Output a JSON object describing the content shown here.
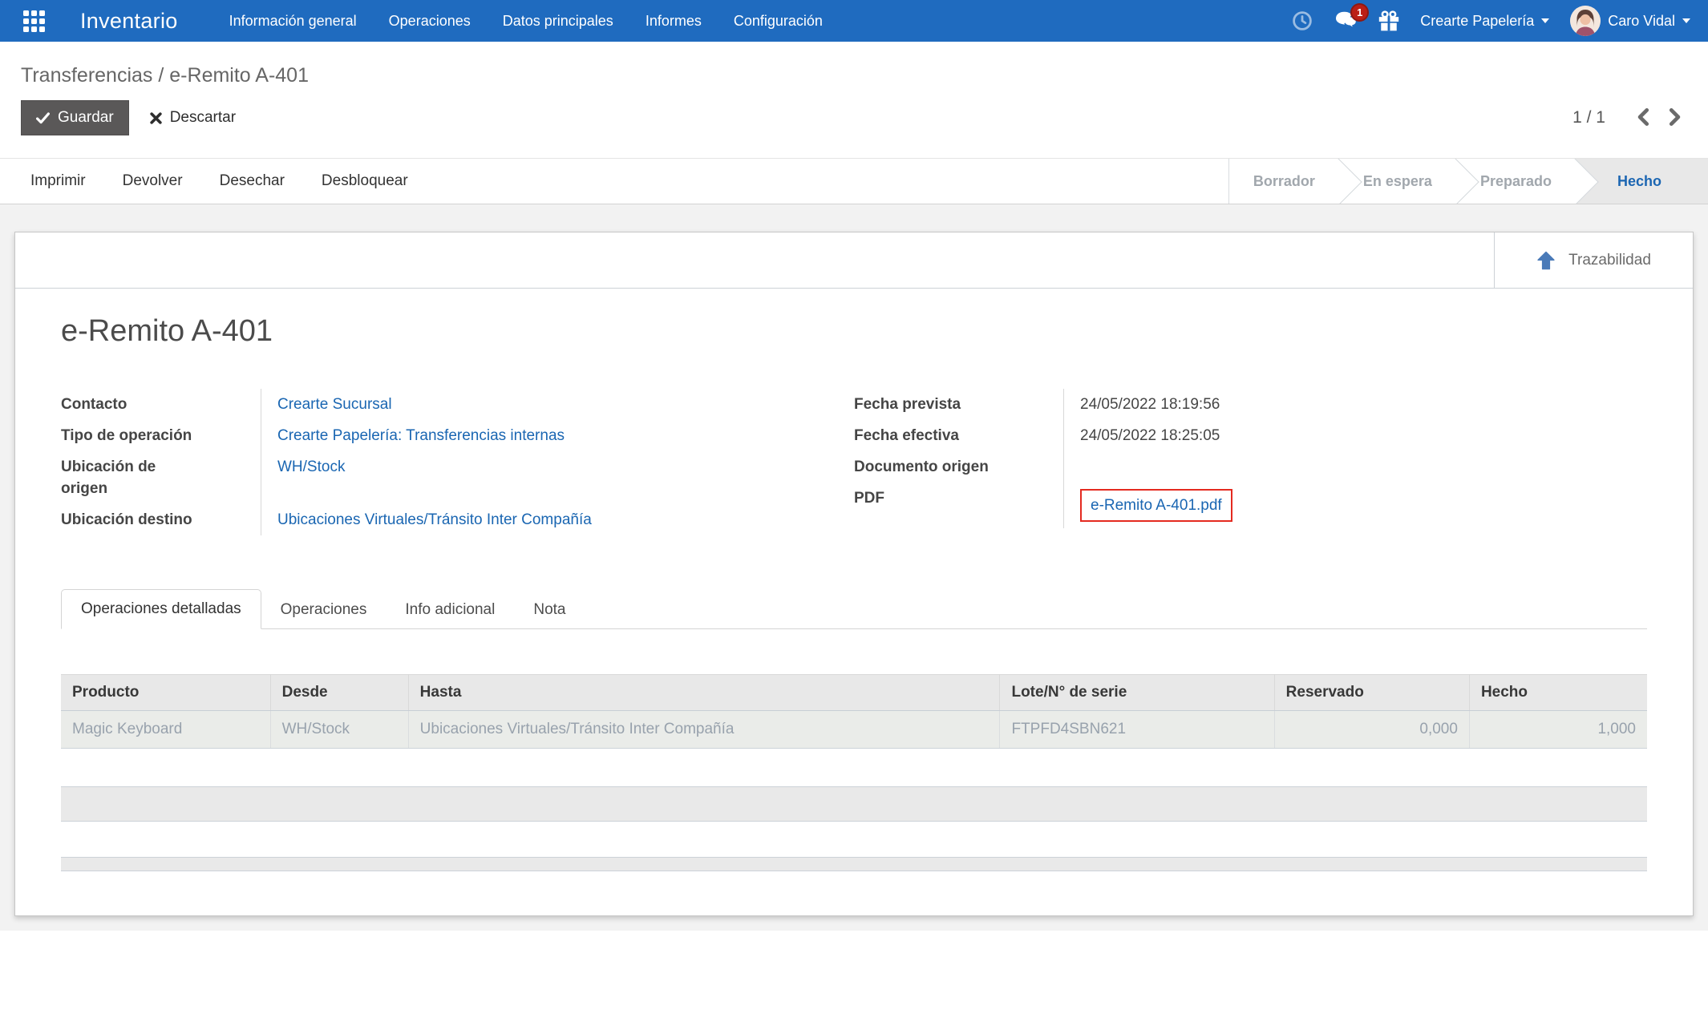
{
  "colors": {
    "navbar_blue": "#1f6bbf",
    "link_blue": "#1a66b2",
    "badge_red": "#bb1f16",
    "highlight_red": "#e42a20",
    "active_status_blue": "#1c66b2"
  },
  "navbar": {
    "brand": "Inventario",
    "menus": [
      "Información general",
      "Operaciones",
      "Datos principales",
      "Informes",
      "Configuración"
    ],
    "message_count": "1",
    "company": "Crearte Papelería",
    "user": "Caro Vidal"
  },
  "breadcrumb": {
    "parent": "Transferencias",
    "separator": "/",
    "current": "e-Remito A-401"
  },
  "controls": {
    "save": "Guardar",
    "discard": "Descartar",
    "pager": "1 / 1"
  },
  "statusbar": {
    "buttons": [
      "Imprimir",
      "Devolver",
      "Desechar",
      "Desbloquear"
    ],
    "steps": [
      {
        "label": "Borrador",
        "active": false
      },
      {
        "label": "En espera",
        "active": false
      },
      {
        "label": "Preparado",
        "active": false
      },
      {
        "label": "Hecho",
        "active": true
      }
    ]
  },
  "form": {
    "traceability_label": "Trazabilidad",
    "title": "e-Remito A-401",
    "left_fields": [
      {
        "label": "Contacto",
        "value": "Crearte Sucursal"
      },
      {
        "label": "Tipo de operación",
        "value": "Crearte Papelería: Transferencias internas"
      },
      {
        "label": "Ubicación de origen",
        "value": "WH/Stock"
      },
      {
        "label": "Ubicación destino",
        "value": "Ubicaciones Virtuales/Tránsito Inter Compañía"
      }
    ],
    "right_fields": [
      {
        "label": "Fecha prevista",
        "value": "24/05/2022 18:19:56"
      },
      {
        "label": "Fecha efectiva",
        "value": "24/05/2022 18:25:05"
      },
      {
        "label": "Documento origen",
        "value": ""
      },
      {
        "label": "PDF",
        "value": "e-Remito A-401.pdf"
      }
    ],
    "tabs": [
      {
        "label": "Operaciones detalladas",
        "active": true
      },
      {
        "label": "Operaciones",
        "active": false
      },
      {
        "label": "Info adicional",
        "active": false
      },
      {
        "label": "Nota",
        "active": false
      }
    ],
    "table": {
      "columns": [
        "Producto",
        "Desde",
        "Hasta",
        "Lote/N° de serie",
        "Reservado",
        "Hecho"
      ],
      "rows": [
        [
          "Magic Keyboard",
          "WH/Stock",
          "Ubicaciones Virtuales/Tránsito Inter Compañía",
          "FTPFD4SBN621",
          "0,000",
          "1,000"
        ]
      ]
    }
  }
}
